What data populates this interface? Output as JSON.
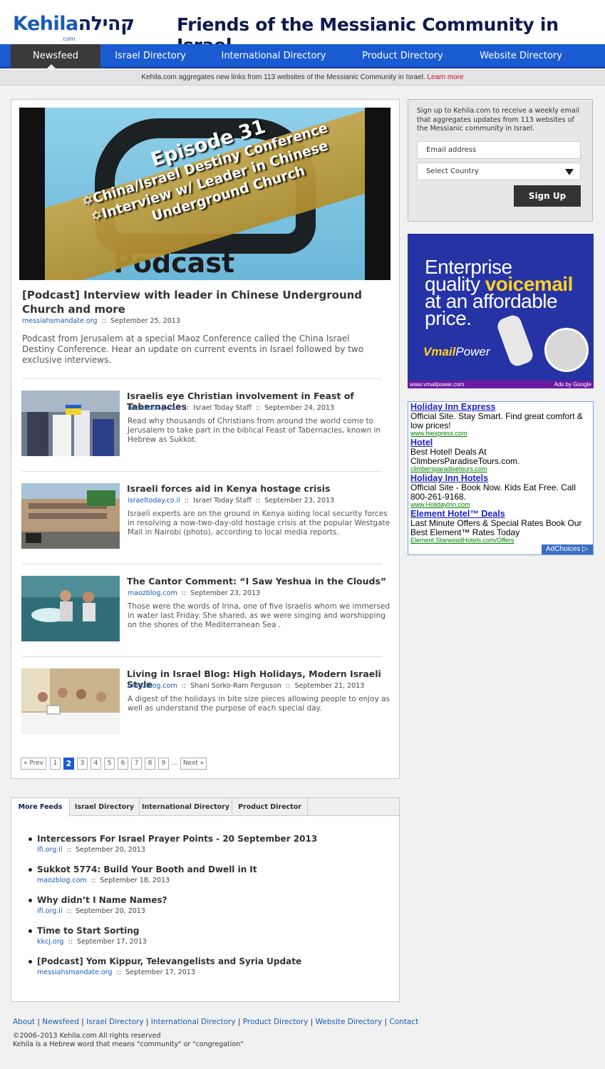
{
  "header": {
    "logo_latin": "Kehila",
    "logo_hebrew": "קהילה",
    "logo_sub": ".com",
    "site_title": "Friends of the Messianic Community in Israel"
  },
  "nav": {
    "items": [
      {
        "label": "Newsfeed",
        "active": true
      },
      {
        "label": "Israel Directory"
      },
      {
        "label": "International Directory"
      },
      {
        "label": "Product Directory"
      },
      {
        "label": "Website Directory"
      }
    ]
  },
  "announcement": {
    "text": "Kehila.com aggregates new links from 113 websites of the Messianic Community in Israel.",
    "link": "Learn more"
  },
  "hero": {
    "episode": "Episode 31",
    "line1": "✡China/Israel Destiny Conference",
    "line2": "✡Interview w/ Leader in Chinese",
    "line3": "Underground Church",
    "podcast": "Podcast"
  },
  "lead": {
    "title": "[Podcast] Interview with leader in Chinese Underground Church and more",
    "source": "messiahsmandate.org",
    "sep": "::",
    "date": "September 25, 2013",
    "description": "Podcast from Jerusalem at a special Maoz Conference called the China Israel Destiny Conference. Hear an update on current events in Israel followed by two exclusive interviews."
  },
  "articles": [
    {
      "title": "Israelis eye Christian involvement in Feast of Tabernacles",
      "source": "israeltoday.co.il",
      "author": "Israel Today Staff",
      "date": "September 24, 2013",
      "description": "Read why thousands of Christians from around the world come to Jerusalem to take part in the biblical Feast of Tabernacles, known in Hebrew as Sukkot."
    },
    {
      "title": "Israeli forces aid in Kenya hostage crisis",
      "source": "israeltoday.co.il",
      "author": "Israel Today Staff",
      "date": "September 23, 2013",
      "description": "Israeli experts are on the ground in Kenya aiding local security forces in resolving a now-two-day-old hostage crisis at the popular Westgate Mall in Nairobi (photo), according to local media reports."
    },
    {
      "title": "The Cantor Comment: “I Saw Yeshua in the Clouds”",
      "source": "maozblog.com",
      "author": "",
      "date": "September 23, 2013",
      "description": "Those were the words of Irina, one of five Israelis whom we immersed in water last Friday. She shared, as we were singing and worshipping on the shores of the Mediterranean Sea ."
    },
    {
      "title": "Living in Israel Blog: High Holidays, Modern Israeli Style",
      "source": "maozblog.com",
      "author": "Shani Sorko-Ram Ferguson",
      "date": "September 21, 2013",
      "description": "A digest of the holidays in bite size pieces allowing people to enjoy as well as understand the purpose of each special day."
    }
  ],
  "pager": {
    "prev": "« Prev",
    "pages": [
      "1",
      "2",
      "3",
      "4",
      "5",
      "6",
      "7",
      "8",
      "9"
    ],
    "current": "2",
    "dots": "...",
    "next": "Next »"
  },
  "feeds_tabs": [
    "More Feeds",
    "Israel Directory",
    "International Directory",
    "Product Director"
  ],
  "feeds": [
    {
      "title": "Intercessors For Israel Prayer Points - 20 September 2013",
      "source": "ifi.org.il",
      "date": "September 20, 2013"
    },
    {
      "title": "Sukkot 5774: Build Your Booth and Dwell in It",
      "source": "maozblog.com",
      "date": "September 18, 2013"
    },
    {
      "title": "Why didn’t I Name Names?",
      "source": "ifi.org.il",
      "date": "September 20, 2013"
    },
    {
      "title": "Time to Start Sorting",
      "source": "kkcj.org",
      "date": "September 17, 2013"
    },
    {
      "title": "[Podcast] Yom Kippur, Televangelists and Syria Update",
      "source": "messiahsmandate.org",
      "date": "September 17, 2013"
    }
  ],
  "signup": {
    "text": "Sign up to Kehila.com to receive a weekly email that aggregates updates from 113 websites of the Messianic community in Israel.",
    "email_placeholder": "Email address",
    "country_placeholder": "Select Country",
    "button": "Sign Up"
  },
  "ad_banner": {
    "line1": "Enterprise",
    "line2a": "quality ",
    "line2b": "voicemail",
    "line3": "at an affordable",
    "line4": "price.",
    "brand_a": "Vmail",
    "brand_b": "Power",
    "url": "www.vmailpower.com",
    "ads_by": "Ads by Google"
  },
  "text_ads": [
    {
      "title": "Holiday Inn Express",
      "body": "Official Site. Stay Smart. Find great comfort & low prices!",
      "url": "www.hiexpress.com"
    },
    {
      "title": "Hotel",
      "body": "Best Hotel! Deals At ClimbersParadiseTours.com.",
      "url": "climbersparadisetours.com"
    },
    {
      "title": "Holiday Inn Hotels",
      "body": "Official Site - Book Now. Kids Eat Free. Call 800-261-9168.",
      "url": "www.HolidayInn.com"
    },
    {
      "title": "Element Hotel™ Deals",
      "body": "Last Minute Offers & Special Rates Book Our Best Element™ Rates Today",
      "url": "Element.StarwoodHotels.com/Offers"
    }
  ],
  "adchoices": "AdChoices ▷",
  "footer": {
    "links": [
      "About",
      "Newsfeed",
      "Israel Directory",
      "International Directory",
      "Product Directory",
      "Website Directory",
      "Contact"
    ],
    "copyright": "©2006–2013  Kehila.com  All rights reserved",
    "note": "Kehila is a Hebrew word that means \"community\" or \"congregation\""
  }
}
